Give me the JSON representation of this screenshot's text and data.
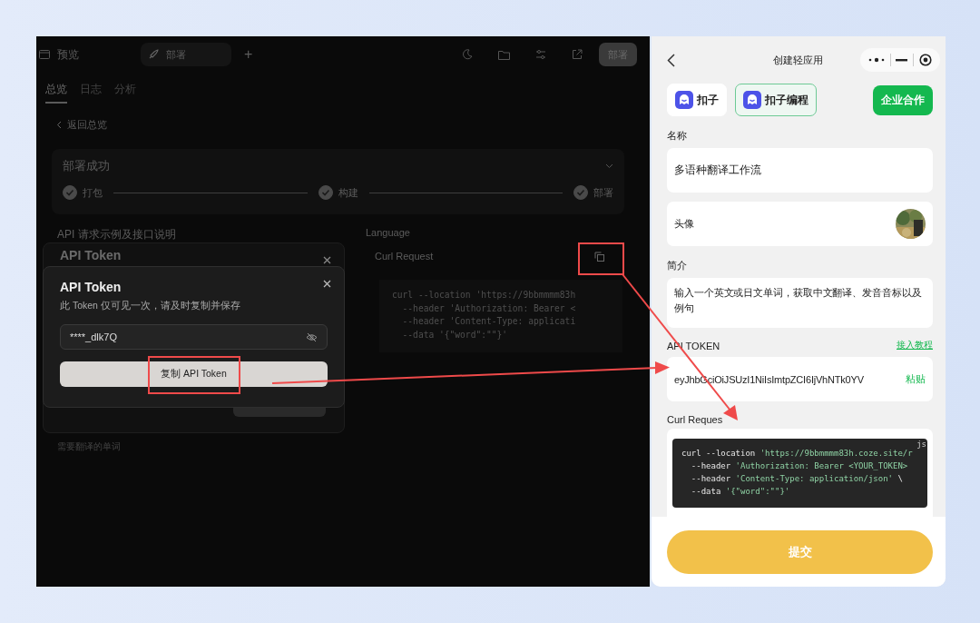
{
  "left": {
    "topbar": {
      "preview_label": "预览",
      "tab_label": "部署",
      "add": "+",
      "deploy_button": "部署"
    },
    "tabs": [
      {
        "label": "总览",
        "selected": true
      },
      {
        "label": "日志",
        "selected": false
      },
      {
        "label": "分析",
        "selected": false
      }
    ],
    "back_link": "返回总览",
    "deploy_card": {
      "title": "部署成功",
      "steps": [
        {
          "label": "打包",
          "done": true
        },
        {
          "label": "构建",
          "done": true
        },
        {
          "label": "部署",
          "done": true
        }
      ]
    },
    "api_section": {
      "title": "API 请求示例及接口说明",
      "language_label": "Language",
      "language_value": "Curl Request",
      "field_label": "需要翻译的单词",
      "code_lines": [
        "curl --location 'https://9bbmmmm83h",
        "  --header 'Authorization: Bearer <",
        "  --header 'Content-Type: applicati",
        "  --data '{\"word\":\"\"}'"
      ]
    },
    "back_dialog": {
      "title": "API Token"
    },
    "dialog": {
      "title": "API Token",
      "subtitle": "此 Token 仅可见一次，请及时复制并保存",
      "token": "****_dlk7Q",
      "copy_button": "复制 API Token"
    }
  },
  "phone": {
    "title": "创建轻应用",
    "brands": [
      {
        "label": "扣子",
        "selected": false
      },
      {
        "label": "扣子编程",
        "selected": true
      }
    ],
    "partner_button": "企业合作",
    "name_label": "名称",
    "name_value": "多语种翻译工作流",
    "avatar_label": "头像",
    "intro_label": "简介",
    "intro_value": "输入一个英文或日文单词，获取中文翻译、发音音标以及例句",
    "token_label": "API TOKEN",
    "tutorial_link": "接入教程",
    "token_value": "eyJhbGciOiJSUzI1NiIsImtpZCI6IjVhNTk0YV",
    "paste": "粘贴",
    "curl_label": "Curl Reques",
    "code_lang": "js",
    "code_lines": [
      [
        {
          "kind": "plain",
          "text": "curl --location "
        },
        {
          "kind": "string",
          "text": "'https://9bbmmmm83h.coze.site/r"
        }
      ],
      [
        {
          "kind": "plain",
          "text": "  --header "
        },
        {
          "kind": "string",
          "text": "'Authorization: Bearer <YOUR_TOKEN>"
        }
      ],
      [
        {
          "kind": "plain",
          "text": "  --header "
        },
        {
          "kind": "string",
          "text": "'Content-Type: application/json'"
        },
        {
          "kind": "plain",
          "text": " \\"
        }
      ],
      [
        {
          "kind": "plain",
          "text": "  --data "
        },
        {
          "kind": "string",
          "text": "'{\"word\":\"\"}'"
        }
      ]
    ],
    "submit_button": "提交"
  }
}
